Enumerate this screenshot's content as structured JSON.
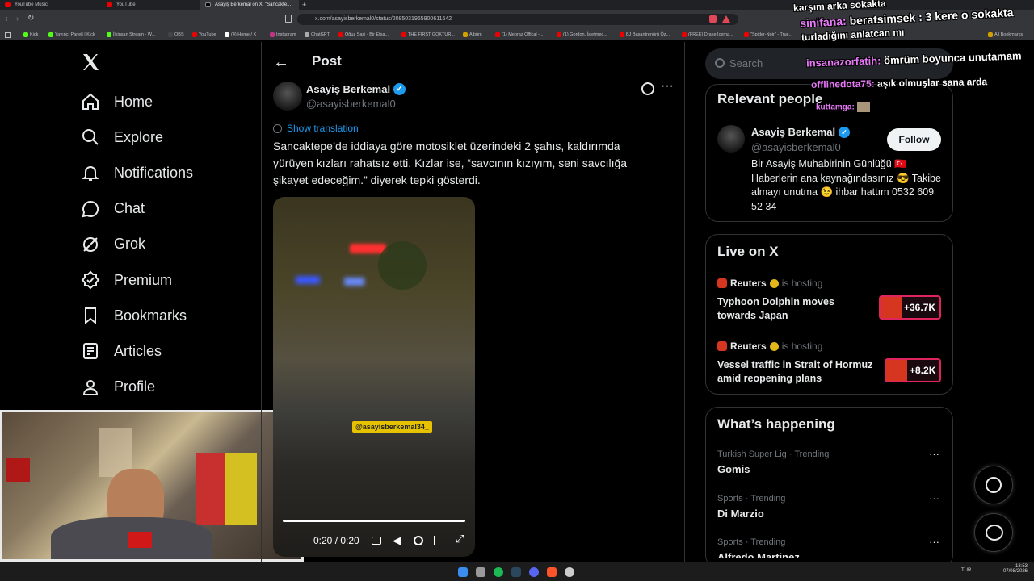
{
  "browser": {
    "tabs": [
      {
        "label": "YouTube Music"
      },
      {
        "label": "YouTube"
      },
      {
        "label": "Asayiş Berkemal on X: \"Sancakte..."
      }
    ],
    "url": "x.com/asayisberkemal0/status/2085031965900611642",
    "bookmarks": [
      "Kick",
      "Yayıncı Paneli | Kick",
      "İlkinsan Stream - W...",
      "OBS",
      "YouTube",
      "(4) Home / X",
      "Instagram",
      "ChatGPT",
      "Oğuz Sasi - Bir Efsa...",
      "THE FIRST GOKTUR...",
      "Albüm",
      "(1) Mepraz Offical -...",
      "(1) Gordon, İşletmec...",
      "BJ Başantrenörü Öz...",
      "(FREE) Drake Icema...",
      "\"Spider-Noir\" - True...",
      "All Bookmarks"
    ]
  },
  "nav": {
    "items": [
      {
        "label": "Home",
        "icon": "home-icon"
      },
      {
        "label": "Explore",
        "icon": "search-icon"
      },
      {
        "label": "Notifications",
        "icon": "bell-icon"
      },
      {
        "label": "Chat",
        "icon": "chat-bubble-icon"
      },
      {
        "label": "Grok",
        "icon": "grok-icon"
      },
      {
        "label": "Premium",
        "icon": "premium-icon"
      },
      {
        "label": "Bookmarks",
        "icon": "bookmark-icon"
      },
      {
        "label": "Articles",
        "icon": "article-icon"
      },
      {
        "label": "Profile",
        "icon": "person-icon"
      }
    ]
  },
  "post": {
    "header": "Post",
    "author_name": "Asayiş Berkemal",
    "author_handle": "@asayisberkemal0",
    "show_translation": "Show translation",
    "text": "Sancaktepe’de iddiaya göre motosiklet üzerindeki 2 şahıs, kaldırımda yürüyen kızları rahatsız etti. Kızlar ise, “savcının kızıyım, seni savcılığa şikayet edeceğim.” diyerek tepki gösterdi.",
    "watermark": "@asayisberkemal34_",
    "time": "0:20 / 0:20"
  },
  "sidebar": {
    "search_placeholder": "Search",
    "relevant": {
      "title": "Relevant people",
      "name": "Asayiş Berkemal",
      "handle": "@asayisberkemal0",
      "follow": "Follow",
      "bio": "Bir Asayiş Muhabirinin Günlüğü 🇹🇷 Haberlerin ana kaynağındasınız 😎 Takibe almayı unutma 😉 ihbar hattım 0532 609 52 34"
    },
    "live": {
      "title": "Live on X",
      "items": [
        {
          "host": "Reuters",
          "status": "is hosting",
          "title": "Typhoon Dolphin moves towards Japan",
          "count": "+36.7K"
        },
        {
          "host": "Reuters",
          "status": "is hosting",
          "title": "Vessel traffic in Strait of Hormuz amid reopening plans",
          "count": "+8.2K"
        }
      ]
    },
    "happening": {
      "title": "What’s happening",
      "items": [
        {
          "meta": "Turkish Super Lig · Trending",
          "topic": "Gomis"
        },
        {
          "meta": "Sports · Trending",
          "topic": "Di Marzio"
        },
        {
          "meta": "Sports · Trending",
          "topic": "Alfredo Martinez"
        }
      ]
    }
  },
  "chat_overlay": [
    {
      "user": "",
      "text": "karşım arka sokakta"
    },
    {
      "user": "sinifana:",
      "text": "beratsimsek : 3 kere o sokakta"
    },
    {
      "user": "",
      "text": "turladığını anlatcan mı"
    },
    {
      "user": "insanazorfatih:",
      "text": "ömrüm boyunca unutamam"
    },
    {
      "user": "offlinedota75:",
      "text": "aşık olmuşlar sana arda"
    },
    {
      "user": "kuttamga:",
      "text": ""
    }
  ],
  "taskbar": {
    "lang": "TUR",
    "time": "13:53",
    "date": "07/08/2026"
  }
}
